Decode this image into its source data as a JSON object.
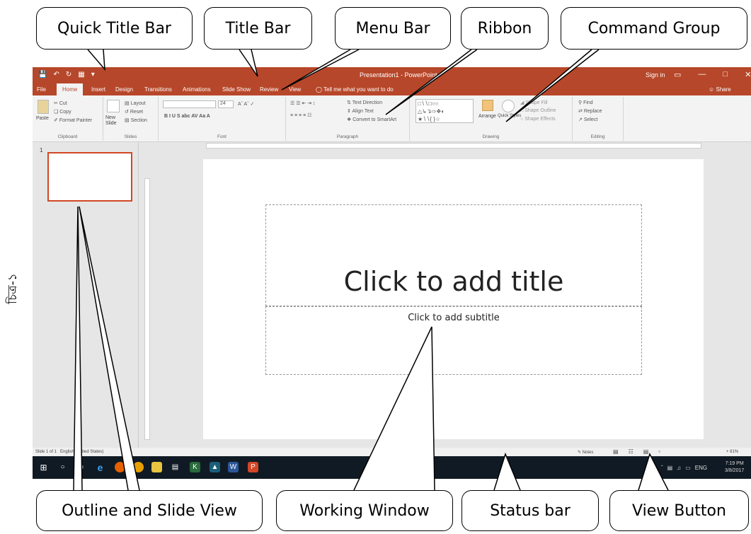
{
  "callouts": {
    "quick_title_bar": "Quick Title Bar",
    "title_bar": "Title Bar",
    "menu_bar": "Menu Bar",
    "ribbon": "Ribbon",
    "command_group": "Command Group",
    "outline_slide_view": "Outline and Slide View",
    "working_window": "Working Window",
    "status_bar": "Status bar",
    "view_button": "View  Button"
  },
  "side_label": "চিত্র-১",
  "app": {
    "title": "Presentation1 - PowerPoint",
    "sign_in": "Sign in",
    "window_controls": [
      "▭",
      "—",
      "□",
      "✕"
    ],
    "share": "Share",
    "tell_me": "Tell me what you want to do",
    "tabs": [
      "File",
      "Home",
      "Insert",
      "Design",
      "Transitions",
      "Animations",
      "Slide Show",
      "Review",
      "View"
    ],
    "active_tab": "Home"
  },
  "ribbon": {
    "clipboard": {
      "label": "Clipboard",
      "paste": "Paste",
      "cut": "Cut",
      "copy": "Copy",
      "format_painter": "Format Painter"
    },
    "slides": {
      "label": "Slides",
      "new_slide": "New Slide",
      "layout": "Layout",
      "reset": "Reset",
      "section": "Section"
    },
    "font": {
      "label": "Font",
      "size": "24",
      "styles": "B  I  U  S  abc  AV  Aa  A"
    },
    "paragraph": {
      "label": "Paragraph",
      "text_direction": "Text Direction",
      "align_text": "Align Text",
      "smartart": "Convert to SmartArt"
    },
    "drawing": {
      "label": "Drawing",
      "arrange": "Arrange",
      "quick_styles": "Quick Styles",
      "shape_fill": "Shape Fill",
      "shape_outline": "Shape Outline",
      "shape_effects": "Shape Effects"
    },
    "editing": {
      "label": "Editing",
      "find": "Find",
      "replace": "Replace",
      "select": "Select"
    }
  },
  "thumbnail": {
    "number": "1"
  },
  "slide": {
    "title_placeholder": "Click to add title",
    "subtitle_placeholder": "Click to add subtitle"
  },
  "status": {
    "slide_info": "Slide 1 of 1",
    "language": "English (United States)",
    "notes": "Notes",
    "zoom": "+ 81%"
  },
  "taskbar": {
    "language": "ENG",
    "time": "7:19 PM",
    "date": "3/8/2017"
  }
}
